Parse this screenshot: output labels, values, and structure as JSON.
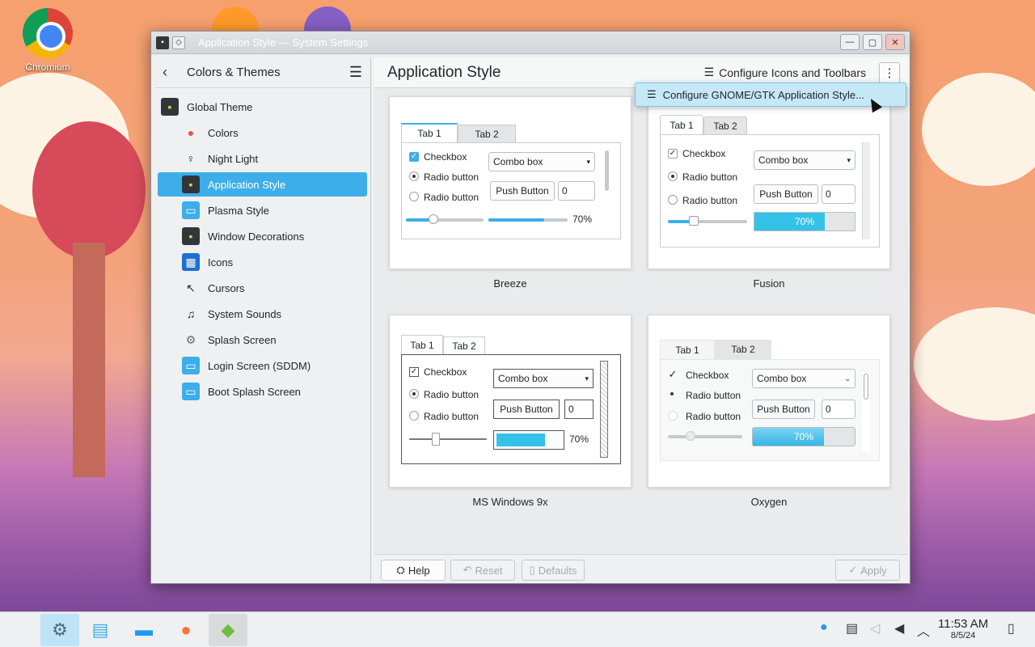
{
  "desktop": {
    "icon_label": "Chromium"
  },
  "window": {
    "title": "Application Style — System Settings",
    "btn_min": "—",
    "btn_max": "▢",
    "btn_close": "✕"
  },
  "sidebar": {
    "title": "Colors & Themes",
    "back": "‹",
    "menu": "☰",
    "items": [
      {
        "label": "Global Theme"
      },
      {
        "label": "Colors"
      },
      {
        "label": "Night Light"
      },
      {
        "label": "Application Style"
      },
      {
        "label": "Plasma Style"
      },
      {
        "label": "Window Decorations"
      },
      {
        "label": "Icons"
      },
      {
        "label": "Cursors"
      },
      {
        "label": "System Sounds"
      },
      {
        "label": "Splash Screen"
      },
      {
        "label": "Login Screen (SDDM)"
      },
      {
        "label": "Boot Splash Screen"
      }
    ]
  },
  "main": {
    "title": "Application Style",
    "configure_icons": "Configure Icons and Toolbars",
    "kebab": "⋮",
    "popup_item": "Configure GNOME/GTK Application Style...",
    "styles": [
      {
        "name": "Breeze"
      },
      {
        "name": "Fusion"
      },
      {
        "name": "MS Windows 9x"
      },
      {
        "name": "Oxygen"
      }
    ],
    "preview": {
      "tab1": "Tab 1",
      "tab2": "Tab 2",
      "checkbox": "Checkbox",
      "radio": "Radio button",
      "combo": "Combo box",
      "push": "Push Button",
      "spin": "0",
      "progress_text": "70%",
      "progress": 0.7
    }
  },
  "footer": {
    "help": "Help",
    "reset": "Reset",
    "defaults": "Defaults",
    "apply": "Apply"
  },
  "taskbar": {
    "time": "11:53 AM",
    "date": "8/5/24"
  },
  "colors": {
    "accent": "#3daee9",
    "progress": "#35c2e8"
  }
}
